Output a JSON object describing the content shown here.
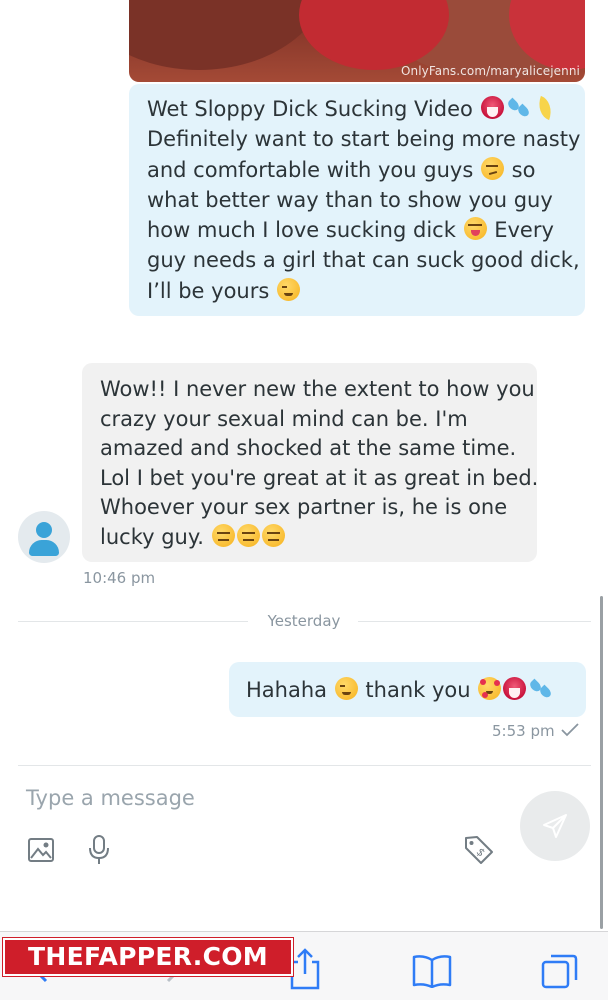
{
  "media_message": {
    "watermark": "OnlyFans.com/maryalicejenni",
    "caption_lines": [
      {
        "text": "Wet Sloppy Dick Sucking Video",
        "emoji": [
          "tongue",
          "sweat-drops",
          "banana"
        ]
      },
      {
        "text": "Definitely want to start being more nasty",
        "emoji": []
      },
      {
        "text": "and comfortable with you guys",
        "emoji_mid": "smirk",
        "after": "so"
      },
      {
        "text": "what better way than to show you guy",
        "emoji": []
      },
      {
        "text": "how much I love sucking dick",
        "emoji_mid": "squint-tongue",
        "after": "Every"
      },
      {
        "text": "guy needs a girl that can suck good dick,",
        "emoji": []
      },
      {
        "text": "I’ll be yours",
        "emoji": [
          "wink"
        ]
      }
    ]
  },
  "received_message": {
    "lines": [
      "Wow!! I never new the extent to how you",
      "crazy your sexual mind can be. I'm",
      "amazed and shocked at the same time.",
      "Lol I bet you're great at it as great in bed.",
      "Whoever your sex partner is, he is one",
      "lucky guy."
    ],
    "trailing_emoji": [
      "expressionless",
      "expressionless",
      "expressionless"
    ],
    "time": "10:46 pm"
  },
  "date_divider": "Yesterday",
  "sent_message": {
    "text_before": "Hahaha",
    "text_middle": "thank you",
    "emoji": [
      "wink",
      "smiling-hearts",
      "tongue",
      "sweat-drops"
    ],
    "time": "5:53 pm",
    "status": "delivered-check"
  },
  "composer": {
    "placeholder": "Type a message",
    "icons": [
      "image-icon",
      "microphone-icon",
      "price-tag-icon",
      "send-icon"
    ]
  },
  "browser_toolbar": {
    "icons": [
      "back-icon",
      "forward-icon",
      "share-icon",
      "bookmarks-icon",
      "tabs-icon"
    ]
  },
  "overlay_logo": "THEFAPPER.COM",
  "colors": {
    "sent_bubble": "#e3f3fb",
    "received_bubble": "#f1f1f1",
    "text": "#2c3438",
    "muted": "#8a96a0",
    "accent": "#3aa3d8",
    "logo_red": "#cf1e2a"
  }
}
